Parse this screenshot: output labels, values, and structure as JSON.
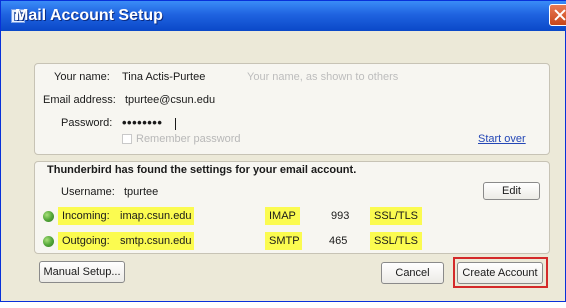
{
  "window": {
    "title": "Mail Account Setup"
  },
  "form": {
    "name_label": "Your name:",
    "name_value": "Tina Actis-Purtee",
    "name_hint": "Your name, as shown to others",
    "email_label": "Email address:",
    "email_value": "tpurtee@csun.edu",
    "password_label": "Password:",
    "password_value": "••••••••",
    "remember_label": "Remember password",
    "remember_checked": false,
    "start_over": "Start over"
  },
  "results": {
    "message": "Thunderbird has found the settings for your email account.",
    "username_label": "Username:",
    "username_value": "tpurtee",
    "edit_label": "Edit",
    "incoming": {
      "label": "Incoming:",
      "server": "imap.csun.edu",
      "protocol": "IMAP",
      "port": "993",
      "security": "SSL/TLS"
    },
    "outgoing": {
      "label": "Outgoing:",
      "server": "smtp.csun.edu",
      "protocol": "SMTP",
      "port": "465",
      "security": "SSL/TLS"
    }
  },
  "footer": {
    "manual_setup": "Manual Setup...",
    "cancel": "Cancel",
    "create_account": "Create Account"
  },
  "colors": {
    "highlight": "#fbfb50",
    "status_ok": "#55a83a",
    "focus_outline": "#d42a2a",
    "title_bar": "#1f63e0"
  },
  "icons": {
    "title": "mail-window-icon",
    "close": "close-x-icon",
    "status": "green-status-dot"
  }
}
